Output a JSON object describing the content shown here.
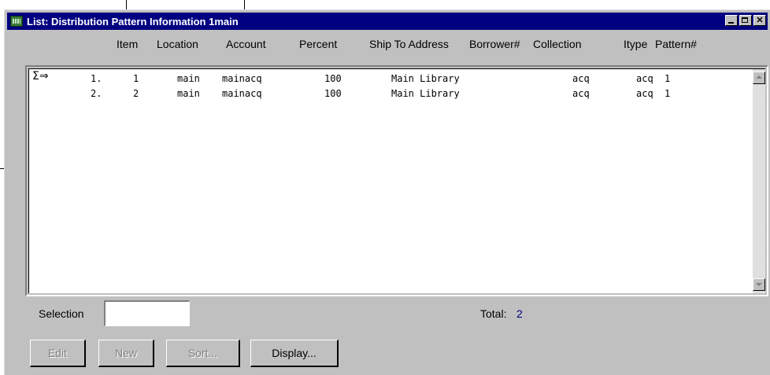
{
  "window": {
    "title": "List: Distribution Pattern Information 1main",
    "minimize": "_",
    "maximize": "□",
    "close": "✕"
  },
  "columns": [
    "Item",
    "Location",
    "Account",
    "Percent",
    "Ship To Address",
    "Borrower#",
    "Collection",
    "Itype",
    "Pattern#"
  ],
  "row_indicator": "Σ⇒",
  "rows": [
    {
      "num": "1.",
      "item": "1",
      "location": "main",
      "account": "mainacq",
      "percent": "100",
      "ship_to": "Main Library",
      "borrower": "",
      "collection": "acq",
      "itype": "acq",
      "pattern": "1"
    },
    {
      "num": "2.",
      "item": "2",
      "location": "main",
      "account": "mainacq",
      "percent": "100",
      "ship_to": "Main Library",
      "borrower": "",
      "collection": "acq",
      "itype": "acq",
      "pattern": "1"
    }
  ],
  "selection": {
    "label": "Selection",
    "value": ""
  },
  "total": {
    "label": "Total:",
    "value": "2"
  },
  "buttons": {
    "edit": "Edit",
    "new": "New",
    "sort": "Sort...",
    "display": "Display..."
  }
}
